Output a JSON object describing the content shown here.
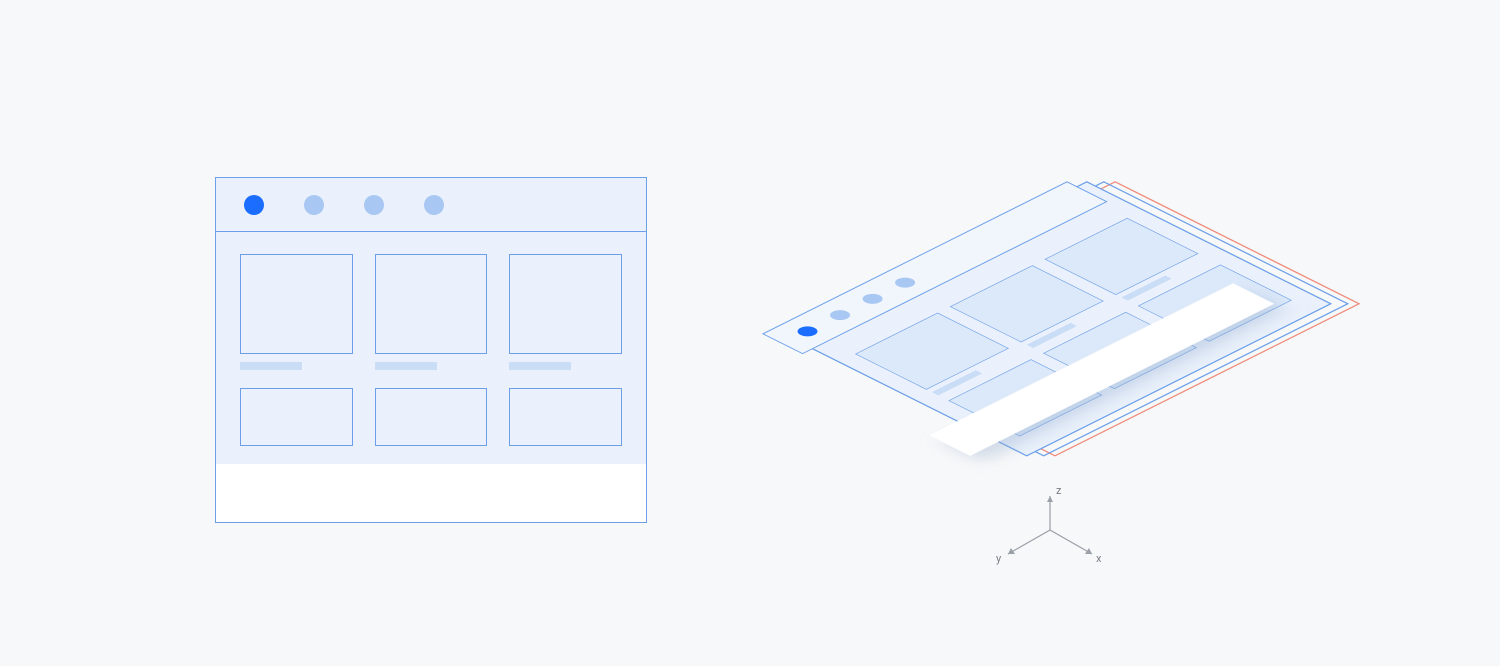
{
  "colors": {
    "page_bg": "#f7f8f9",
    "panel_fill": "#eaf1fc",
    "panel_fill_light": "#f1f6fd",
    "panel_border": "#6d9fe8",
    "dot_active": "#1a6dff",
    "dot_inactive": "#a9c7f3",
    "caption_bar": "#c9ddf6",
    "red_layer": "#f08a7a",
    "white_overlay": "#ffffff",
    "axis": "#9aa0a8"
  },
  "flat_mockup": {
    "tab_dots": [
      {
        "state": "active"
      },
      {
        "state": "inactive"
      },
      {
        "state": "inactive"
      },
      {
        "state": "inactive"
      }
    ],
    "grid_rows": 2,
    "grid_cols": 3
  },
  "iso_mockup": {
    "tab_dots": [
      {
        "state": "active"
      },
      {
        "state": "inactive"
      },
      {
        "state": "inactive"
      },
      {
        "state": "inactive"
      }
    ],
    "grid_rows": 2,
    "grid_cols": 3,
    "layers": [
      "red-base",
      "blue-panel",
      "header-strip",
      "white-overlay"
    ]
  },
  "axes": {
    "z_label": "z",
    "y_label": "y",
    "x_label": "x"
  }
}
